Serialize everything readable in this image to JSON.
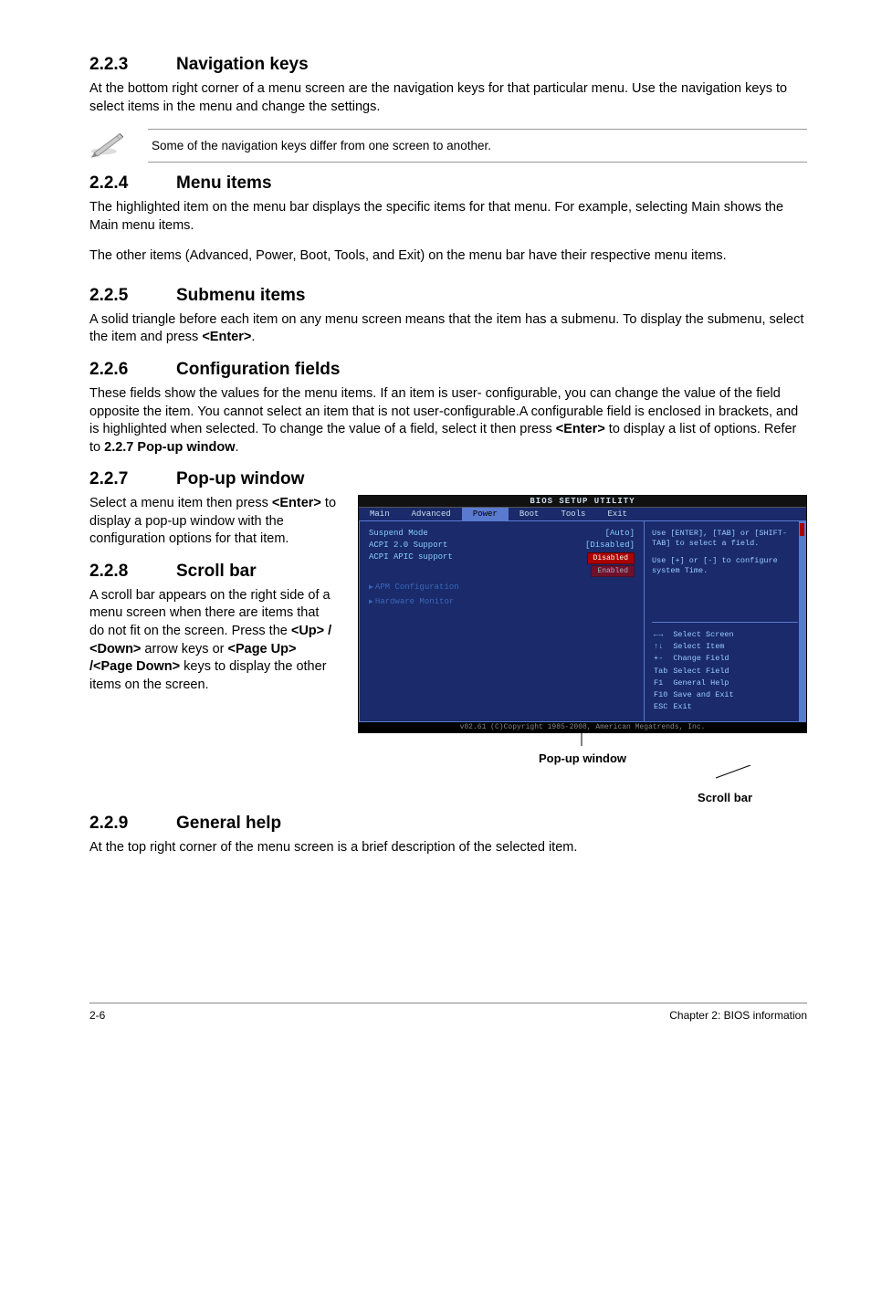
{
  "sections": {
    "s223": {
      "num": "2.2.3",
      "title": "Navigation keys",
      "p1": "At the bottom right corner of a menu screen are the navigation keys for that particular menu. Use the navigation keys to select items in the menu and change the settings.",
      "note": "Some of the navigation keys differ from one screen to another."
    },
    "s224": {
      "num": "2.2.4",
      "title": "Menu items",
      "p1": "The highlighted item on the menu bar displays the specific items for that menu. For example, selecting Main shows the Main menu items.",
      "p2": "The other items (Advanced, Power, Boot, Tools, and Exit) on the menu bar have their respective menu items."
    },
    "s225": {
      "num": "2.2.5",
      "title": "Submenu items",
      "p1a": "A solid triangle before each item on any menu screen means that the item has a submenu. To display the submenu, select the item and press ",
      "p1b": "<Enter>",
      "p1c": "."
    },
    "s226": {
      "num": "2.2.6",
      "title": "Configuration fields",
      "p1a": "These fields show the values for the menu items. If an item is user- configurable, you can change the value of the field opposite the item. You cannot select an item that is not user-configurable.A configurable field is enclosed in brackets, and is highlighted when selected. To change the value of a field, select it then press ",
      "p1b": "<Enter>",
      "p1c": " to display a list of options. Refer to ",
      "p1d": "2.2.7 Pop-up window",
      "p1e": "."
    },
    "s227": {
      "num": "2.2.7",
      "title": "Pop-up window",
      "p1a": "Select a menu item then press ",
      "p1b": "<Enter>",
      "p1c": " to display a pop-up window with the configuration options for that item."
    },
    "s228": {
      "num": "2.2.8",
      "title": "Scroll bar",
      "p1a": "A scroll bar appears on the right side of a menu screen when there are items that do not fit on the screen. Press the ",
      "p1b": "<Up> / <Down>",
      "p1c": " arrow keys or ",
      "p1d": "<Page Up> /<Page Down>",
      "p1e": " keys to display the other items on the screen."
    },
    "s229": {
      "num": "2.2.9",
      "title": "General help",
      "p1": "At the top right corner of the menu screen is a brief description of the selected item."
    }
  },
  "bios": {
    "title": "BIOS SETUP UTILITY",
    "tabs": [
      "Main",
      "Advanced",
      "Power",
      "Boot",
      "Tools",
      "Exit"
    ],
    "selectedTab": 2,
    "items": [
      {
        "label": "Suspend Mode",
        "value": "[Auto]"
      },
      {
        "label": "ACPI 2.0 Support",
        "value": "[Disabled]"
      },
      {
        "label": "ACPI APIC support",
        "value": ""
      }
    ],
    "popup": [
      "Disabled",
      "Enabled"
    ],
    "subitems": [
      "APM Configuration",
      "Hardware Monitor"
    ],
    "helpTop": "Use [ENTER], [TAB] or [SHIFT-TAB] to select a field.",
    "helpTop2": "Use [+] or [-] to configure system Time.",
    "navKeys": [
      {
        "k": "←→",
        "d": "Select Screen"
      },
      {
        "k": "↑↓",
        "d": "Select Item"
      },
      {
        "k": "+-",
        "d": "Change Field"
      },
      {
        "k": "Tab",
        "d": "Select Field"
      },
      {
        "k": "F1",
        "d": "General Help"
      },
      {
        "k": "F10",
        "d": "Save and Exit"
      },
      {
        "k": "ESC",
        "d": "Exit"
      }
    ],
    "footer": "v02.61 (C)Copyright 1985-2008, American Megatrends, Inc."
  },
  "callouts": {
    "popup": "Pop-up window",
    "scrollbar": "Scroll bar"
  },
  "pageFooter": {
    "left": "2-6",
    "right": "Chapter 2: BIOS information"
  }
}
